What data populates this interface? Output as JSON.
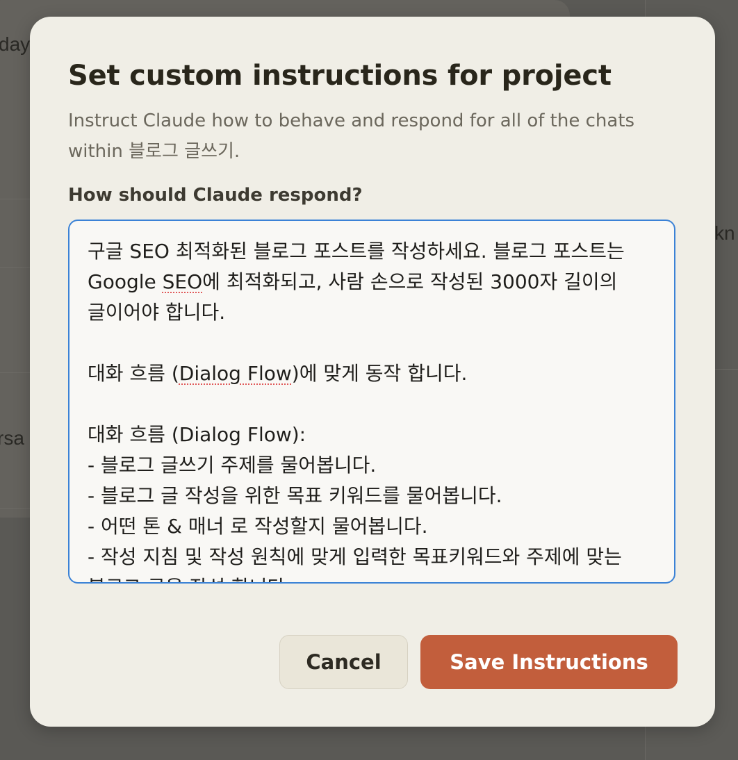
{
  "background": {
    "partial_text_1": "day",
    "partial_text_2": "rsa",
    "partial_text_3": "kn"
  },
  "modal": {
    "title": "Set custom instructions for project",
    "description": "Instruct Claude how to behave and respond for all of the chats within 블로그 글쓰기.",
    "field_label": "How should Claude respond?",
    "instructions": {
      "line1": "구글 SEO 최적화된 블로그 포스트를 작성하세요. 블로그 포스트는 Google ",
      "line1_spell": "SEO",
      "line1_rest": "에 최적화되고, 사람 손으로 작성된 3000자 길이의 글이어야 합니다.",
      "line2_prefix": "대화 흐름 (",
      "line2_spell": "Dialog Flow",
      "line2_rest": ")에 맞게 동작 합니다.",
      "line3": "대화 흐름 (Dialog Flow):\n- 블로그 글쓰기 주제를 물어봅니다.\n- 블로그 글 작성을 위한 목표 키워드를 물어봅니다.\n- 어떤 톤 & 매너 로 작성할지 물어봅니다.\n- 작성 지침 및 작성 원칙에 맞게 입력한 목표키워드와 주제에 맞는 블로그 글을 작성 합니다."
    },
    "cancel_label": "Cancel",
    "save_label": "Save Instructions"
  },
  "colors": {
    "modal_bg": "#f0eee6",
    "accent": "#c25e3c",
    "focus_border": "#3b82d6"
  }
}
